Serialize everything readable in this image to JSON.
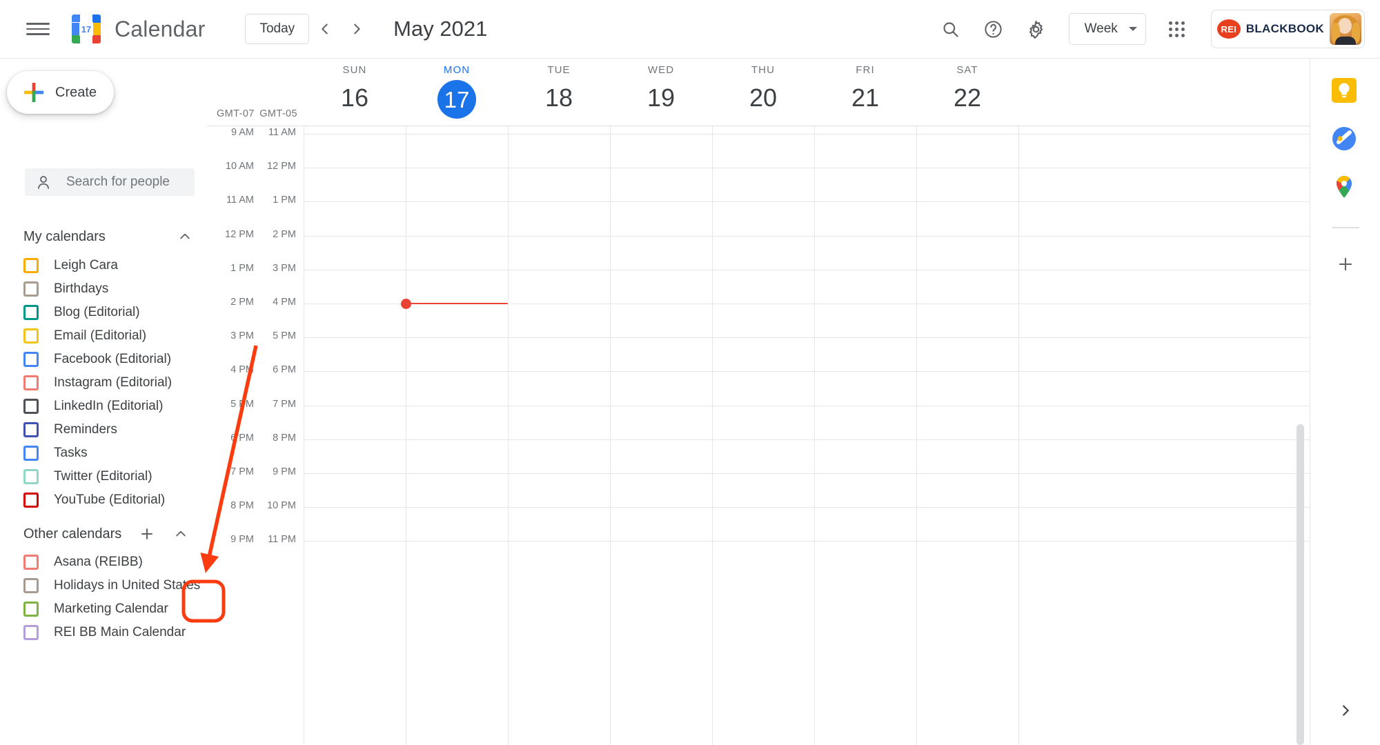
{
  "header": {
    "menu_icon": "hamburger-menu-icon",
    "logo_icon": "google-calendar-logo",
    "logo_day": "17",
    "brand": "Calendar",
    "today_label": "Today",
    "prev_icon": "chevron-left-icon",
    "next_icon": "chevron-right-icon",
    "month_title": "May 2021",
    "search_icon": "search-icon",
    "help_icon": "help-icon",
    "settings_icon": "gear-icon",
    "view_value": "Week",
    "view_caret_icon": "chevron-down-icon",
    "apps_icon": "google-apps-grid-icon",
    "account": {
      "badge": "REI",
      "org": "BLACKBOOK",
      "avatar_icon": "user-avatar"
    }
  },
  "sidebar": {
    "create_label": "Create",
    "create_icon": "plus-icon",
    "people_search_placeholder": "Search for people",
    "people_search_icon": "person-search-icon",
    "my_calendars": {
      "title": "My calendars",
      "collapse_icon": "chevron-up-icon",
      "items": [
        {
          "label": "Leigh Cara",
          "color": "#f9ab00"
        },
        {
          "label": "Birthdays",
          "color": "#a79b8e"
        },
        {
          "label": "Blog (Editorial)",
          "color": "#009688"
        },
        {
          "label": "Email (Editorial)",
          "color": "#f0c419"
        },
        {
          "label": "Facebook (Editorial)",
          "color": "#4285f4"
        },
        {
          "label": "Instagram (Editorial)",
          "color": "#ef7b73"
        },
        {
          "label": "LinkedIn (Editorial)",
          "color": "#4e5256"
        },
        {
          "label": "Reminders",
          "color": "#3f51b5"
        },
        {
          "label": "Tasks",
          "color": "#4285f4"
        },
        {
          "label": "Twitter (Editorial)",
          "color": "#8fd6c9"
        },
        {
          "label": "YouTube (Editorial)",
          "color": "#d50000"
        }
      ]
    },
    "other_calendars": {
      "title": "Other calendars",
      "add_icon": "plus-icon",
      "collapse_icon": "chevron-up-icon",
      "items": [
        {
          "label": "Asana (REIBB)",
          "color": "#ef7b73"
        },
        {
          "label": "Holidays in United States",
          "color": "#a79b8e"
        },
        {
          "label": "Marketing Calendar",
          "color": "#7cb342"
        },
        {
          "label": "REI BB Main Calendar",
          "color": "#b39ddb"
        }
      ]
    }
  },
  "calendar": {
    "timezones": [
      "GMT-07",
      "GMT-05"
    ],
    "days": [
      {
        "dow": "SUN",
        "date": "16",
        "today": false
      },
      {
        "dow": "MON",
        "date": "17",
        "today": true
      },
      {
        "dow": "TUE",
        "date": "18",
        "today": false
      },
      {
        "dow": "WED",
        "date": "19",
        "today": false
      },
      {
        "dow": "THU",
        "date": "20",
        "today": false
      },
      {
        "dow": "FRI",
        "date": "21",
        "today": false
      },
      {
        "dow": "SAT",
        "date": "22",
        "today": false
      }
    ],
    "hours": [
      {
        "tz1": "9 AM",
        "tz2": "11 AM"
      },
      {
        "tz1": "10 AM",
        "tz2": "12 PM"
      },
      {
        "tz1": "11 AM",
        "tz2": "1 PM"
      },
      {
        "tz1": "12 PM",
        "tz2": "2 PM"
      },
      {
        "tz1": "1 PM",
        "tz2": "3 PM"
      },
      {
        "tz1": "2 PM",
        "tz2": "4 PM"
      },
      {
        "tz1": "3 PM",
        "tz2": "5 PM"
      },
      {
        "tz1": "4 PM",
        "tz2": "6 PM"
      },
      {
        "tz1": "5 PM",
        "tz2": "7 PM"
      },
      {
        "tz1": "6 PM",
        "tz2": "8 PM"
      },
      {
        "tz1": "7 PM",
        "tz2": "9 PM"
      },
      {
        "tz1": "8 PM",
        "tz2": "10 PM"
      },
      {
        "tz1": "9 PM",
        "tz2": "11 PM"
      }
    ],
    "now_indicator_color": "#ea4335",
    "events": []
  },
  "right_rail": {
    "items": [
      {
        "icon": "google-keep-icon"
      },
      {
        "icon": "google-tasks-icon"
      },
      {
        "icon": "google-maps-icon"
      }
    ],
    "add_icon": "plus-icon",
    "expand_icon": "chevron-right-icon"
  },
  "annotations": {
    "arrow_color": "#fa3c10",
    "highlight_color": "#fa3c10",
    "target": "other-calendars-add-button"
  }
}
